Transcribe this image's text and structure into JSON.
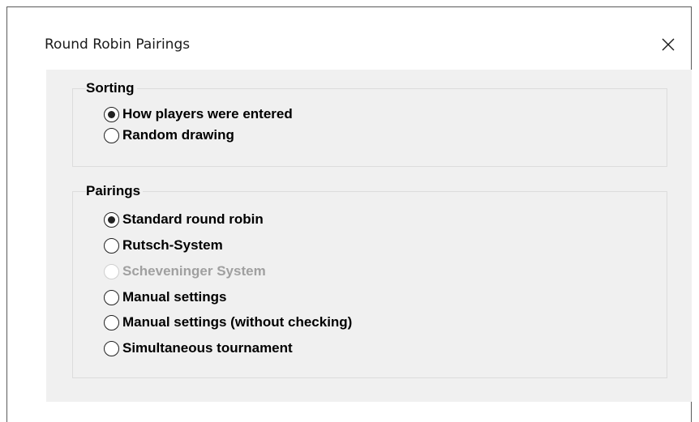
{
  "dialog": {
    "title": "Round Robin Pairings",
    "close_icon": "close-icon"
  },
  "sorting": {
    "legend": "Sorting",
    "options": [
      {
        "label": "How players were entered",
        "selected": true,
        "enabled": true
      },
      {
        "label": "Random drawing",
        "selected": false,
        "enabled": true
      }
    ]
  },
  "pairings": {
    "legend": "Pairings",
    "options": [
      {
        "label": "Standard round robin",
        "selected": true,
        "enabled": true
      },
      {
        "label": "Rutsch-System",
        "selected": false,
        "enabled": true
      },
      {
        "label": "Scheveninger System",
        "selected": false,
        "enabled": false
      },
      {
        "label": "Manual settings",
        "selected": false,
        "enabled": true
      },
      {
        "label": "Manual settings (without checking)",
        "selected": false,
        "enabled": true
      },
      {
        "label": "Simultaneous tournament",
        "selected": false,
        "enabled": true
      }
    ]
  },
  "colors": {
    "content_background": "#f0f0f0",
    "disabled_text": "#a0a0a0",
    "group_border": "#dcdcdc"
  }
}
